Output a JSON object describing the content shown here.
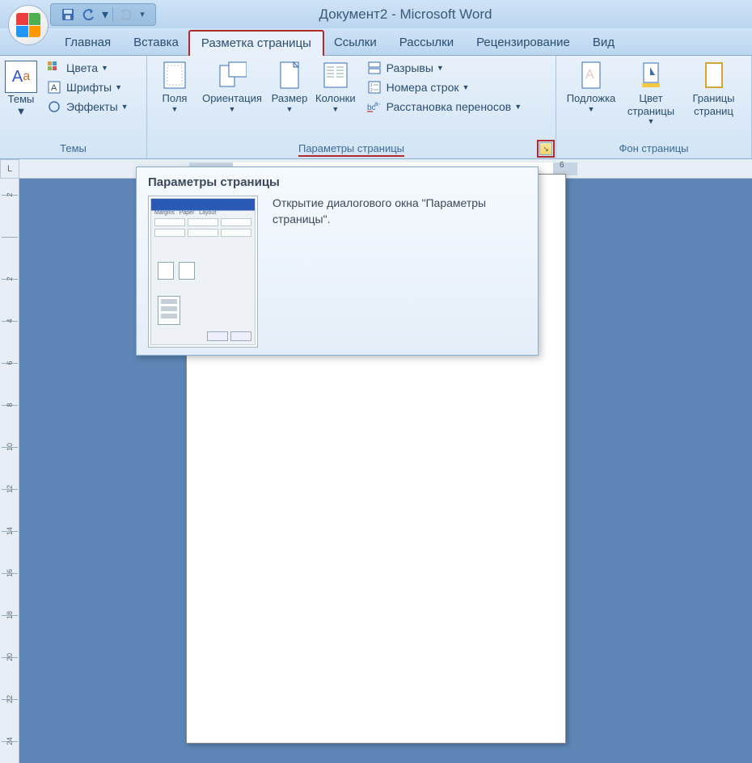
{
  "title": "Документ2 - Microsoft Word",
  "qat": {
    "save": "save",
    "undo": "undo",
    "redo": "redo"
  },
  "tabs": [
    {
      "label": "Главная"
    },
    {
      "label": "Вставка"
    },
    {
      "label": "Разметка страницы",
      "active": true
    },
    {
      "label": "Ссылки"
    },
    {
      "label": "Рассылки"
    },
    {
      "label": "Рецензирование"
    },
    {
      "label": "Вид"
    }
  ],
  "groups": {
    "themes": {
      "title": "Темы",
      "main": "Темы",
      "colors": "Цвета",
      "fonts": "Шрифты",
      "effects": "Эффекты"
    },
    "pagesetup": {
      "title": "Параметры страницы",
      "margins": "Поля",
      "orientation": "Ориентация",
      "size": "Размер",
      "columns": "Колонки",
      "breaks": "Разрывы",
      "lines": "Номера строк",
      "hyphen": "Расстановка переносов"
    },
    "background": {
      "title": "Фон страницы",
      "watermark": "Подложка",
      "color": "Цвет страницы",
      "borders": "Границы страниц"
    }
  },
  "tooltip": {
    "title": "Параметры страницы",
    "text": "Открытие диалогового окна \"Параметры страницы\"."
  },
  "ruler": {
    "corner": "L",
    "marker": "6",
    "vlabels": [
      "2",
      "",
      "2",
      "4",
      "6",
      "8",
      "10",
      "12",
      "14",
      "16",
      "18",
      "20",
      "22",
      "24"
    ]
  }
}
